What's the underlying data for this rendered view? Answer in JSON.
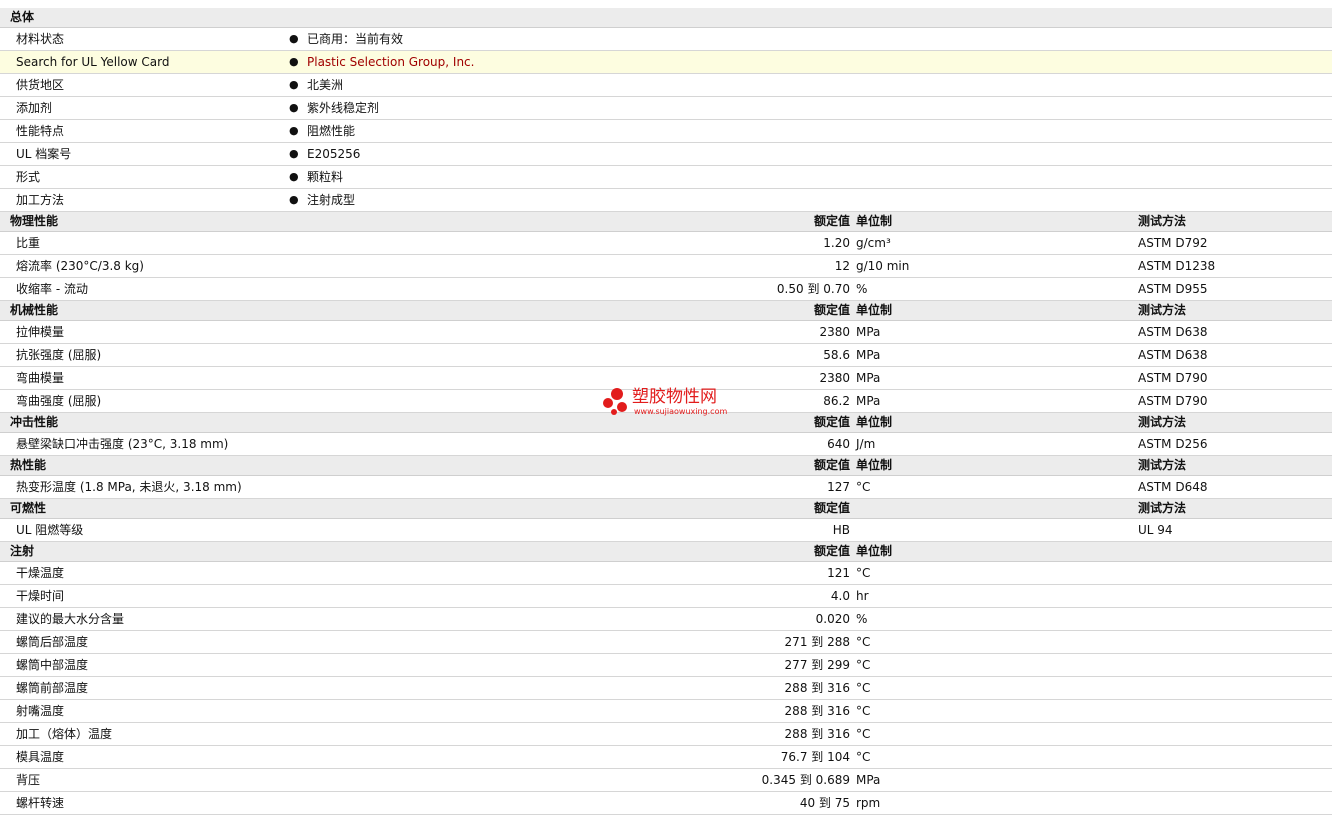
{
  "general": {
    "section_title": "总体",
    "rows": [
      {
        "label": "材料状态",
        "value": "已商用：当前有效"
      },
      {
        "label": "Search for UL Yellow Card",
        "value": "Plastic Selection Group, Inc."
      },
      {
        "label": "供货地区",
        "value": "北美洲"
      },
      {
        "label": "添加剂",
        "value": "紫外线稳定剂"
      },
      {
        "label": "性能特点",
        "value": "阻燃性能"
      },
      {
        "label": "UL 档案号",
        "value": "E205256"
      },
      {
        "label": "形式",
        "value": "颗粒料"
      },
      {
        "label": "加工方法",
        "value": "注射成型"
      }
    ]
  },
  "bullet": "●",
  "sections": [
    {
      "title": "物理性能",
      "h_value": "额定值",
      "h_unit": "单位制",
      "h_test": "测试方法",
      "rows": [
        {
          "label": "比重",
          "value": "1.20",
          "unit": "g/cm³",
          "test": "ASTM D792"
        },
        {
          "label": "熔流率  (230°C/3.8 kg)",
          "value": "12",
          "unit": "g/10 min",
          "test": "ASTM D1238"
        },
        {
          "label": "收缩率  - 流动",
          "value": "0.50 到  0.70",
          "unit": "%",
          "test": "ASTM D955"
        }
      ]
    },
    {
      "title": "机械性能",
      "h_value": "额定值",
      "h_unit": "单位制",
      "h_test": "测试方法",
      "rows": [
        {
          "label": "拉伸模量",
          "value": "2380",
          "unit": "MPa",
          "test": "ASTM D638"
        },
        {
          "label": "抗张强度  (屈服)",
          "value": "58.6",
          "unit": "MPa",
          "test": "ASTM D638"
        },
        {
          "label": "弯曲模量",
          "value": "2380",
          "unit": "MPa",
          "test": "ASTM D790"
        },
        {
          "label": "弯曲强度  (屈服)",
          "value": "86.2",
          "unit": "MPa",
          "test": "ASTM D790"
        }
      ]
    },
    {
      "title": "冲击性能",
      "h_value": "额定值",
      "h_unit": "单位制",
      "h_test": "测试方法",
      "rows": [
        {
          "label": "悬壁梁缺口冲击强度  (23°C, 3.18 mm)",
          "value": "640",
          "unit": "J/m",
          "test": "ASTM D256"
        }
      ]
    },
    {
      "title": "热性能",
      "h_value": "额定值",
      "h_unit": "单位制",
      "h_test": "测试方法",
      "rows": [
        {
          "label": "热变形温度  (1.8 MPa, 未退火, 3.18 mm)",
          "value": "127",
          "unit": "°C",
          "test": "ASTM D648"
        }
      ]
    },
    {
      "title": "可燃性",
      "h_value": "额定值",
      "h_unit": "",
      "h_test": "测试方法",
      "rows": [
        {
          "label": "UL 阻燃等级",
          "value": "HB",
          "unit": "",
          "test": "UL 94"
        }
      ]
    },
    {
      "title": "注射",
      "h_value": "额定值",
      "h_unit": "单位制",
      "h_test": "",
      "rows": [
        {
          "label": "干燥温度",
          "value": "121",
          "unit": "°C",
          "test": ""
        },
        {
          "label": "干燥时间",
          "value": "4.0",
          "unit": "hr",
          "test": ""
        },
        {
          "label": "建议的最大水分含量",
          "value": "0.020",
          "unit": "%",
          "test": ""
        },
        {
          "label": "螺筒后部温度",
          "value": "271 到  288",
          "unit": "°C",
          "test": ""
        },
        {
          "label": "螺筒中部温度",
          "value": "277 到  299",
          "unit": "°C",
          "test": ""
        },
        {
          "label": "螺筒前部温度",
          "value": "288 到  316",
          "unit": "°C",
          "test": ""
        },
        {
          "label": "射嘴温度",
          "value": "288 到  316",
          "unit": "°C",
          "test": ""
        },
        {
          "label": "加工（熔体）温度",
          "value": "288 到  316",
          "unit": "°C",
          "test": ""
        },
        {
          "label": "模具温度",
          "value": "76.7 到  104",
          "unit": "°C",
          "test": ""
        },
        {
          "label": "背压",
          "value": "0.345 到  0.689",
          "unit": "MPa",
          "test": ""
        },
        {
          "label": "螺杆转速",
          "value": "40 到  75",
          "unit": "rpm",
          "test": ""
        }
      ]
    }
  ],
  "watermark": {
    "title": "塑胶物性网",
    "url": "www.sujiaowuxing.com",
    "color": "#e21c1c"
  },
  "colors": {
    "section_bg": "#ececec",
    "highlight_bg": "#fdfde0",
    "link_text": "#a00000"
  }
}
